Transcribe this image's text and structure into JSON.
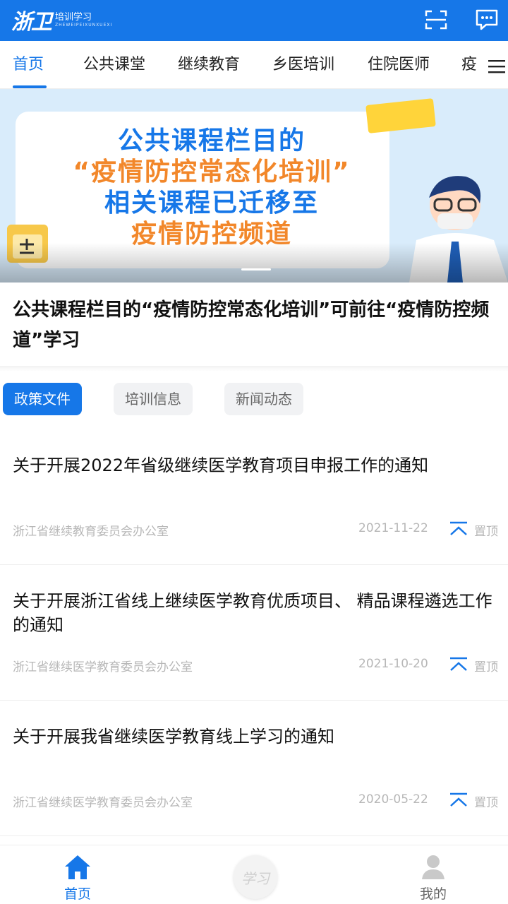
{
  "header": {
    "logo_mark": "浙卫",
    "logo_sub": "培训学习",
    "logo_en": "ZHEWEIPEIXUNXUEXI",
    "brand_color": "#1677e8",
    "icons": [
      "scan-icon",
      "message-icon"
    ]
  },
  "tabs": [
    {
      "label": "首页",
      "active": true
    },
    {
      "label": "公共课堂"
    },
    {
      "label": "继续教育"
    },
    {
      "label": "乡医培训"
    },
    {
      "label": "住院医师"
    },
    {
      "label": "疫"
    }
  ],
  "banner": {
    "lines": [
      "公共课程栏目的",
      "“疫情防控常态化培训”",
      "相关课程已迁移至",
      "疫情防控频道"
    ],
    "blue": "#1677e8",
    "orange": "#f2872a"
  },
  "notice": "公共课程栏目的“疫情防控常态化培训”可前往“疫情防控频道”学习",
  "categories": [
    {
      "label": "政策文件",
      "active": true
    },
    {
      "label": "培训信息"
    },
    {
      "label": "新闻动态"
    }
  ],
  "news": [
    {
      "title": "关于开展2022年省级继续医学教育项目申报工作的通知",
      "source": "浙江省继续教育委员会办公室",
      "date": "2021-11-22",
      "pin": "置顶"
    },
    {
      "title": "关于开展浙江省线上继续医学教育优质项目、 精品课程遴选工作的通知",
      "source": "浙江省继续医学教育委员会办公室",
      "date": "2021-10-20",
      "pin": "置顶"
    },
    {
      "title": "关于开展我省继续医学教育线上学习的通知",
      "source": "浙江省继续医学教育委员会办公室",
      "date": "2020-05-22",
      "pin": "置顶"
    }
  ],
  "bottom_nav": {
    "home": "首页",
    "center": "学习",
    "mine": "我的"
  }
}
